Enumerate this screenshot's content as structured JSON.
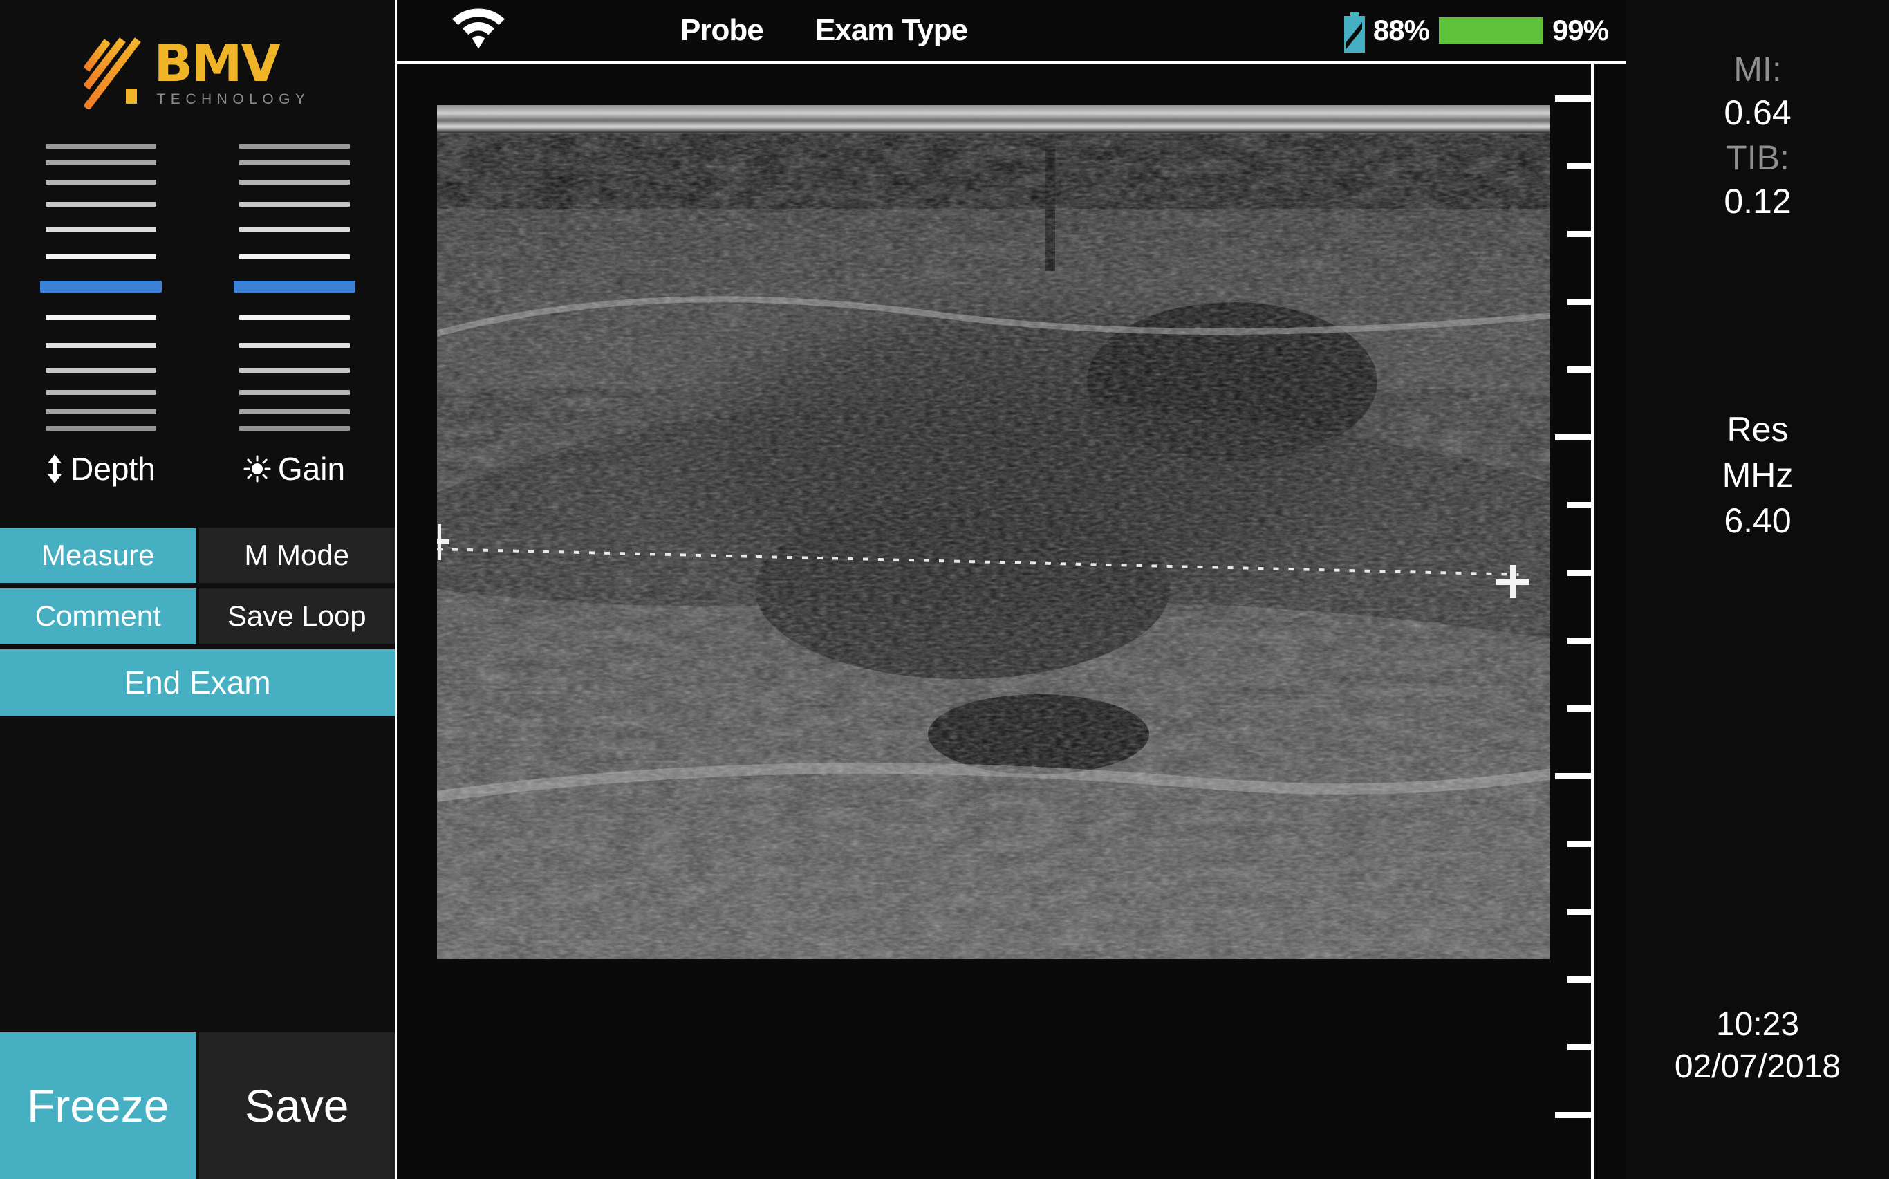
{
  "brand": {
    "name": "BMV",
    "tagline": "TECHNOLOGY",
    "mark_color": "#f0923a",
    "text_color": "#f0b429"
  },
  "sidebar": {
    "controls": [
      {
        "name": "depth",
        "label": "Depth",
        "icon": "updown-arrow-icon",
        "position_index": 6
      },
      {
        "name": "gain",
        "label": "Gain",
        "icon": "brightness-sun-icon",
        "position_index": 6
      }
    ],
    "buttons": [
      {
        "name": "measure",
        "label": "Measure",
        "style": "teal"
      },
      {
        "name": "m-mode",
        "label": "M Mode",
        "style": "dark"
      },
      {
        "name": "comment",
        "label": "Comment",
        "style": "teal"
      },
      {
        "name": "save-loop",
        "label": "Save Loop",
        "style": "dark"
      },
      {
        "name": "end-exam",
        "label": "End Exam",
        "style": "teal"
      },
      {
        "name": "freeze",
        "label": "Freeze",
        "style": "teal"
      },
      {
        "name": "save",
        "label": "Save",
        "style": "dark"
      }
    ]
  },
  "topbar": {
    "wifi_icon": "wifi-icon",
    "probe_label": "Probe",
    "exam_type_label": "Exam Type",
    "probe_battery": {
      "icon": "battery-charging-icon",
      "value": "88%",
      "color": "#46b0c2"
    },
    "system_battery": {
      "icon": "battery-bar-icon",
      "value": "99%",
      "color": "#5ec23a"
    }
  },
  "info_panel": {
    "mi_label": "MI:",
    "mi_value": "0.64",
    "tib_label": "TIB:",
    "tib_value": "0.12",
    "res_label": "Res",
    "res_unit": "MHz",
    "res_value": "6.40",
    "time": "10:23",
    "date": "02/07/2018"
  },
  "scan": {
    "mode_note": "B-Mode ultrasound image with dotted caliper measurement line"
  },
  "colors": {
    "teal": "#46b0c2",
    "dark_button": "#232323",
    "slider_thumb": "#3b82d6",
    "green": "#5ec23a",
    "panel_bg": "#0c0c0c"
  }
}
